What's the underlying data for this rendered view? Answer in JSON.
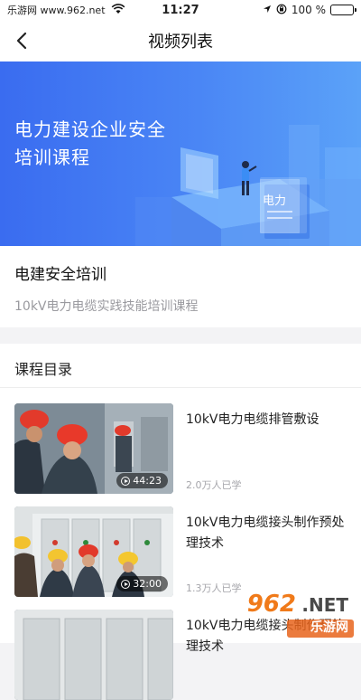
{
  "status_bar": {
    "carrier": "乐游网 www.962.net",
    "time": "11:27",
    "battery": "100 %"
  },
  "nav": {
    "title": "视频列表"
  },
  "banner": {
    "line1": "电力建设企业安全",
    "line2": "培训课程",
    "sign_text": "电力"
  },
  "course": {
    "name": "电建安全培训",
    "subtitle": "10kV电力电缆实践技能培训课程"
  },
  "catalog": {
    "heading": "课程目录",
    "items": [
      {
        "title": "10kV电力电缆排管敷设",
        "views": "2.0万人已学",
        "duration": "44:23"
      },
      {
        "title": "10kV电力电缆接头制作预处理技术",
        "views": "1.3万人已学",
        "duration": "32:00"
      },
      {
        "title": "10kV电力电缆接头制作预处理技术",
        "views": "",
        "duration": ""
      }
    ]
  },
  "watermark": {
    "number": "962",
    "suffix": ".NET",
    "text": "乐游网"
  },
  "colors": {
    "banner_start": "#3a6cf0",
    "banner_end": "#5ba2f8",
    "text_muted": "#9a9a9f"
  }
}
